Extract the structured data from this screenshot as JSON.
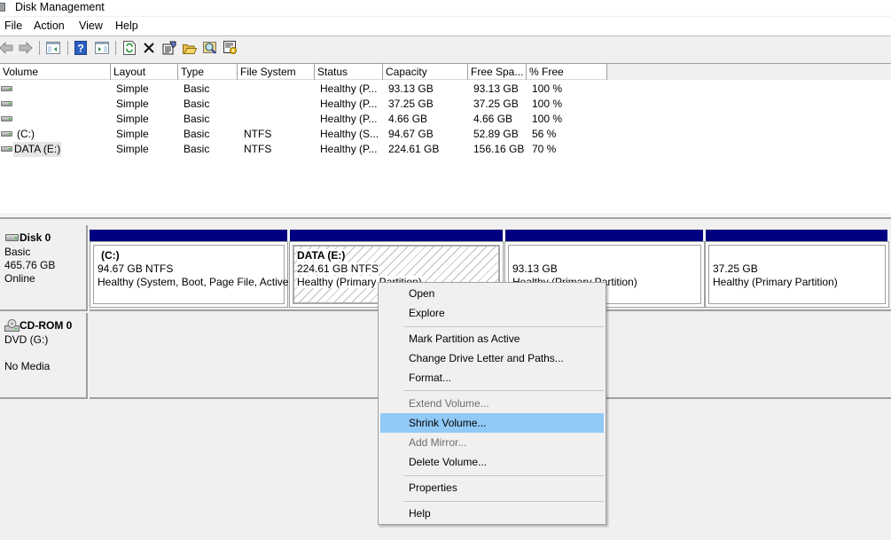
{
  "window": {
    "title": "Disk Management"
  },
  "menu": [
    "File",
    "Action",
    "View",
    "Help"
  ],
  "toolbar": {
    "buttons": [
      {
        "name": "back-button",
        "icon": "arrow-left-icon"
      },
      {
        "name": "forward-button",
        "icon": "arrow-right-icon"
      },
      {
        "name": "show-hide-console-tree-button",
        "icon": "console-tree-icon"
      },
      {
        "name": "help-button",
        "icon": "help-icon"
      },
      {
        "name": "show-hide-action-pane-button",
        "icon": "action-pane-icon"
      },
      {
        "name": "refresh-button",
        "icon": "refresh-icon"
      },
      {
        "name": "delete-button",
        "icon": "close-icon"
      },
      {
        "name": "properties-button",
        "icon": "properties-icon"
      },
      {
        "name": "open-button",
        "icon": "folder-open-icon"
      },
      {
        "name": "explore-button",
        "icon": "magnifier-icon"
      },
      {
        "name": "settings-button",
        "icon": "gear-sheet-icon"
      }
    ]
  },
  "volume_list": {
    "columns": [
      "Volume",
      "Layout",
      "Type",
      "File System",
      "Status",
      "Capacity",
      "Free Spa...",
      "% Free"
    ],
    "rows": [
      {
        "volume": "",
        "layout": "Simple",
        "type": "Basic",
        "fs": "",
        "status": "Healthy (P...",
        "capacity": "93.13 GB",
        "free": "93.13 GB",
        "pct": "100 %"
      },
      {
        "volume": "",
        "layout": "Simple",
        "type": "Basic",
        "fs": "",
        "status": "Healthy (P...",
        "capacity": "37.25 GB",
        "free": "37.25 GB",
        "pct": "100 %"
      },
      {
        "volume": "",
        "layout": "Simple",
        "type": "Basic",
        "fs": "",
        "status": "Healthy (P...",
        "capacity": "4.66 GB",
        "free": "4.66 GB",
        "pct": "100 %"
      },
      {
        "volume": "(C:)",
        "layout": "Simple",
        "type": "Basic",
        "fs": "NTFS",
        "status": "Healthy (S...",
        "capacity": "94.67 GB",
        "free": "52.89 GB",
        "pct": "56 %"
      },
      {
        "volume": "DATA (E:)",
        "layout": "Simple",
        "type": "Basic",
        "fs": "NTFS",
        "status": "Healthy (P...",
        "capacity": "224.61 GB",
        "free": "156.16 GB",
        "pct": "70 %",
        "selected": true
      }
    ]
  },
  "disks": [
    {
      "name": "Disk 0",
      "type": "Basic",
      "size": "465.76 GB",
      "state": "Online",
      "partitions": [
        {
          "label": "(C:)",
          "size": "94.67 GB NTFS",
          "status": "Healthy (System, Boot, Page File, Active,"
        },
        {
          "label": "DATA  (E:)",
          "size": "224.61 GB NTFS",
          "status": "Healthy (Primary Partition)",
          "selected": true
        },
        {
          "label": "",
          "size": "93.13 GB",
          "status": "Healthy (Primary Partition)"
        },
        {
          "label": "",
          "size": "37.25 GB",
          "status": "Healthy (Primary Partition)"
        }
      ]
    },
    {
      "name": "CD-ROM 0",
      "type": "DVD (G:)",
      "state": "No Media"
    }
  ],
  "context_menu": {
    "items": [
      {
        "label": "Open",
        "enabled": true
      },
      {
        "label": "Explore",
        "enabled": true
      },
      {
        "separator": true
      },
      {
        "label": "Mark Partition as Active",
        "enabled": true
      },
      {
        "label": "Change Drive Letter and Paths...",
        "enabled": true
      },
      {
        "label": "Format...",
        "enabled": true
      },
      {
        "separator": true
      },
      {
        "label": "Extend Volume...",
        "enabled": false
      },
      {
        "label": "Shrink Volume...",
        "enabled": true,
        "highlighted": true
      },
      {
        "label": "Add Mirror...",
        "enabled": false
      },
      {
        "label": "Delete Volume...",
        "enabled": true
      },
      {
        "separator": true
      },
      {
        "label": "Properties",
        "enabled": true
      },
      {
        "separator": true
      },
      {
        "label": "Help",
        "enabled": true
      }
    ]
  },
  "colors": {
    "partition_header": "#000080",
    "menu_highlight": "#91c9f7",
    "disabled_text": "#6d6d6d"
  }
}
